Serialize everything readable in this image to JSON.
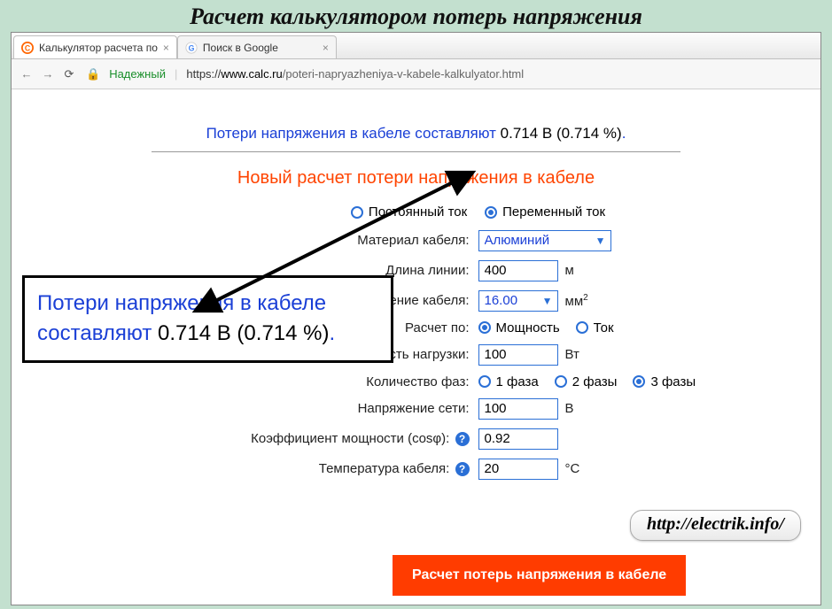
{
  "main_title": "Расчет калькулятором потерь напряжения",
  "tabs": [
    {
      "title": "Калькулятор расчета по",
      "favicon": "calc"
    },
    {
      "title": "Поиск в Google",
      "favicon": "google"
    }
  ],
  "omnibar": {
    "secure_label": "Надежный",
    "scheme": "https://",
    "host": "www.calc.ru",
    "path": "/poteri-napryazheniya-v-kabele-kalkulyator.html"
  },
  "result": {
    "prefix": "Потери напряжения в кабеле составляют ",
    "value": "0.714 В (0.714 %)",
    "suffix": "."
  },
  "callout": {
    "line1": "Потери напряжения в кабеле",
    "line2_prefix": "составляют ",
    "line2_value": "0.714 В (0.714 %)",
    "line2_suffix": "."
  },
  "new_title": "Новый расчет потери напряжения в кабеле",
  "form": {
    "current_type": {
      "options": [
        "Постоянный ток",
        "Переменный ток"
      ],
      "selected": 1
    },
    "material": {
      "label": "Материал кабеля:",
      "value": "Алюминий"
    },
    "length": {
      "label": "Длина линии:",
      "value": "400",
      "unit": "м"
    },
    "section": {
      "label": "Сечение кабеля:",
      "value": "16.00",
      "unit_html": "мм",
      "unit_sup": "2"
    },
    "calc_by": {
      "label": "Расчет по:",
      "options": [
        "Мощность",
        "Ток"
      ],
      "selected": 0
    },
    "power": {
      "label": "Мощность нагрузки:",
      "value": "100",
      "unit": "Вт"
    },
    "phases": {
      "label": "Количество фаз:",
      "options": [
        "1 фаза",
        "2 фазы",
        "3 фазы"
      ],
      "selected": 2
    },
    "voltage": {
      "label": "Напряжение сети:",
      "value": "100",
      "unit": "В"
    },
    "cosphi": {
      "label": "Коэффициент мощности (cosφ):",
      "value": "0.92"
    },
    "temp": {
      "label": "Температура кабеля:",
      "value": "20",
      "unit": "°C"
    }
  },
  "submit_label": "Расчет потерь напряжения в кабеле",
  "watermark": "http://electrik.info/"
}
